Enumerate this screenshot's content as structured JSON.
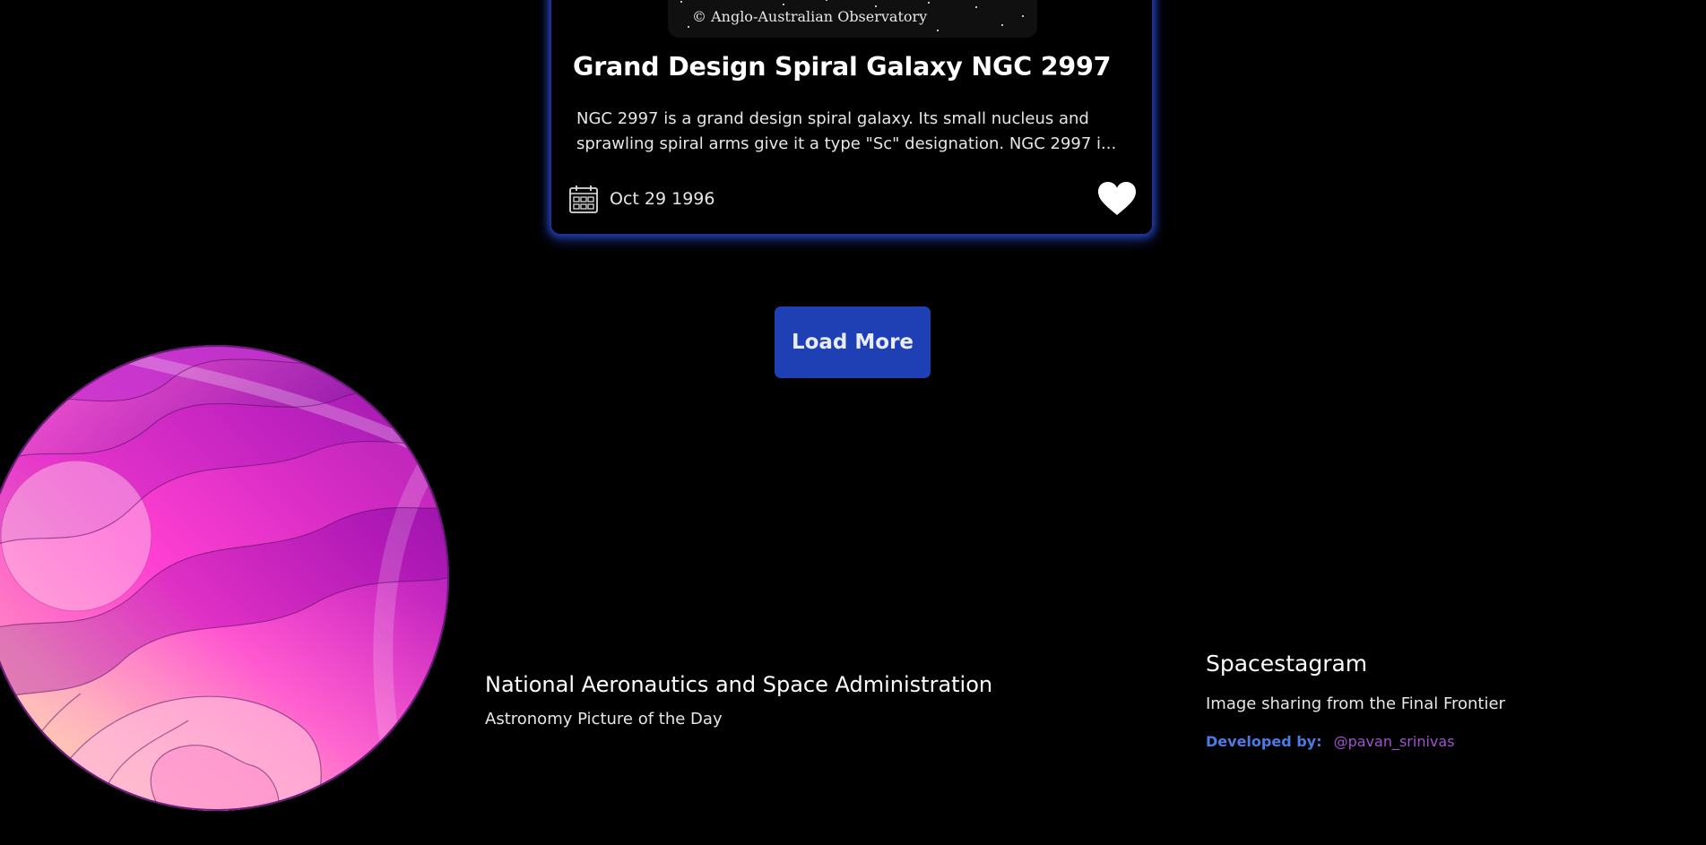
{
  "card": {
    "image_credit": "© Anglo-Australian Observatory",
    "title": "Grand Design Spiral Galaxy NGC 2997",
    "description_line1": "NGC 2997 is a grand design spiral galaxy. Its small nucleus and",
    "description_line2": "sprawling spiral arms give it a type \"Sc\" designation. NGC 2997 i...",
    "date": "Oct 29 1996",
    "icons": {
      "date": "calendar-icon",
      "like": "heart-icon"
    }
  },
  "load_more": {
    "label": "Load More"
  },
  "footer": {
    "nasa_title": "National Aeronautics and Space Administration",
    "nasa_subtitle": "Astronomy Picture of the Day",
    "app_title": "Spacestagram",
    "app_tagline": "Image sharing from the Final Frontier",
    "developed_by_label": "Developed by:",
    "developer_handle": "@pavan_srinivas"
  },
  "colors": {
    "background": "#000000",
    "button": "#1f3fb4",
    "card_glow": "#2846c8",
    "developed_by": "#4c7be6",
    "developer_link": "#a052cf"
  }
}
